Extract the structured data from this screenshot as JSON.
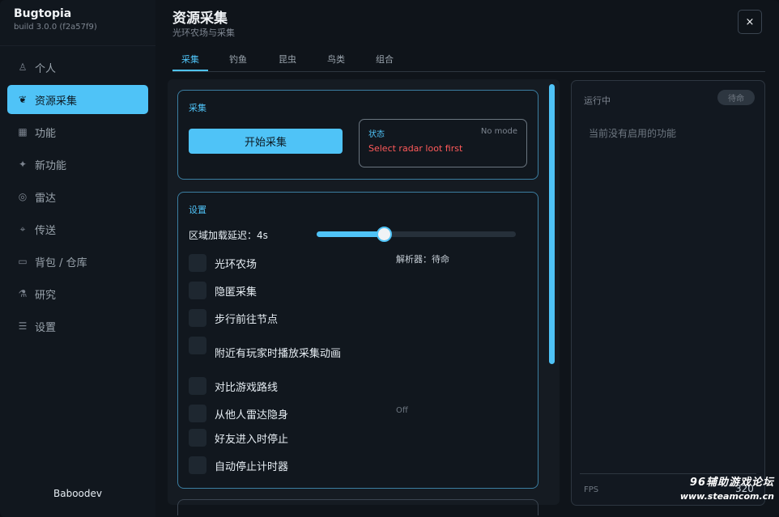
{
  "app": {
    "title": "Bugtopia",
    "build": "build 3.0.0 (f2a57f9)"
  },
  "sidebar": {
    "items": [
      {
        "label": "个人",
        "icon": "user-icon",
        "glyph": "♙"
      },
      {
        "label": "资源采集",
        "icon": "leaf-icon",
        "glyph": "❦"
      },
      {
        "label": "功能",
        "icon": "grid-icon",
        "glyph": "▦"
      },
      {
        "label": "新功能",
        "icon": "sparkle-icon",
        "glyph": "✦"
      },
      {
        "label": "雷达",
        "icon": "radar-icon",
        "glyph": "◎"
      },
      {
        "label": "传送",
        "icon": "location-pin-icon",
        "glyph": "⌖"
      },
      {
        "label": "背包 / 仓库",
        "icon": "backpack-icon",
        "glyph": "▭"
      },
      {
        "label": "研究",
        "icon": "flask-icon",
        "glyph": "⚗"
      },
      {
        "label": "设置",
        "icon": "sliders-icon",
        "glyph": "☰"
      }
    ],
    "active_index": 1,
    "user": "Baboodev"
  },
  "header": {
    "title": "资源采集",
    "subtitle": "光环农场与采集",
    "close_glyph": "×"
  },
  "tabs": [
    "采集",
    "钓鱼",
    "昆虫",
    "鸟类",
    "组合"
  ],
  "collect": {
    "title": "采集",
    "start_label": "开始采集",
    "status": {
      "label": "状态",
      "mode": "No mode",
      "message": "Select radar loot first"
    }
  },
  "settings": {
    "title": "设置",
    "delay_label": "区域加载延迟：4s",
    "delay_fraction": 0.34,
    "parser_status": "解析器：待命",
    "off_label": "Off",
    "options": [
      {
        "label": "光环农场",
        "checked": false
      },
      {
        "label": "隐匿采集",
        "checked": false
      },
      {
        "label": "步行前往节点",
        "checked": false
      },
      {
        "label": "附近有玩家时播放采集动画",
        "checked": false
      },
      {
        "label": "对比游戏路线",
        "checked": false
      },
      {
        "label": "从他人雷达隐身",
        "checked": false
      },
      {
        "label": "好友进入时停止",
        "checked": false
      },
      {
        "label": "自动停止计时器",
        "checked": false
      }
    ]
  },
  "run_panel": {
    "title": "运行中",
    "badge": "待命",
    "empty_text": "当前没有启用的功能",
    "fps_label": "FPS",
    "fps_value": "320"
  },
  "watermark": {
    "line1": "96辅助游戏论坛",
    "line2": "www.steamcom.cn"
  },
  "colors": {
    "accent": "#4fc3f7",
    "error": "#ff5a5a",
    "background": "#0f141a"
  }
}
